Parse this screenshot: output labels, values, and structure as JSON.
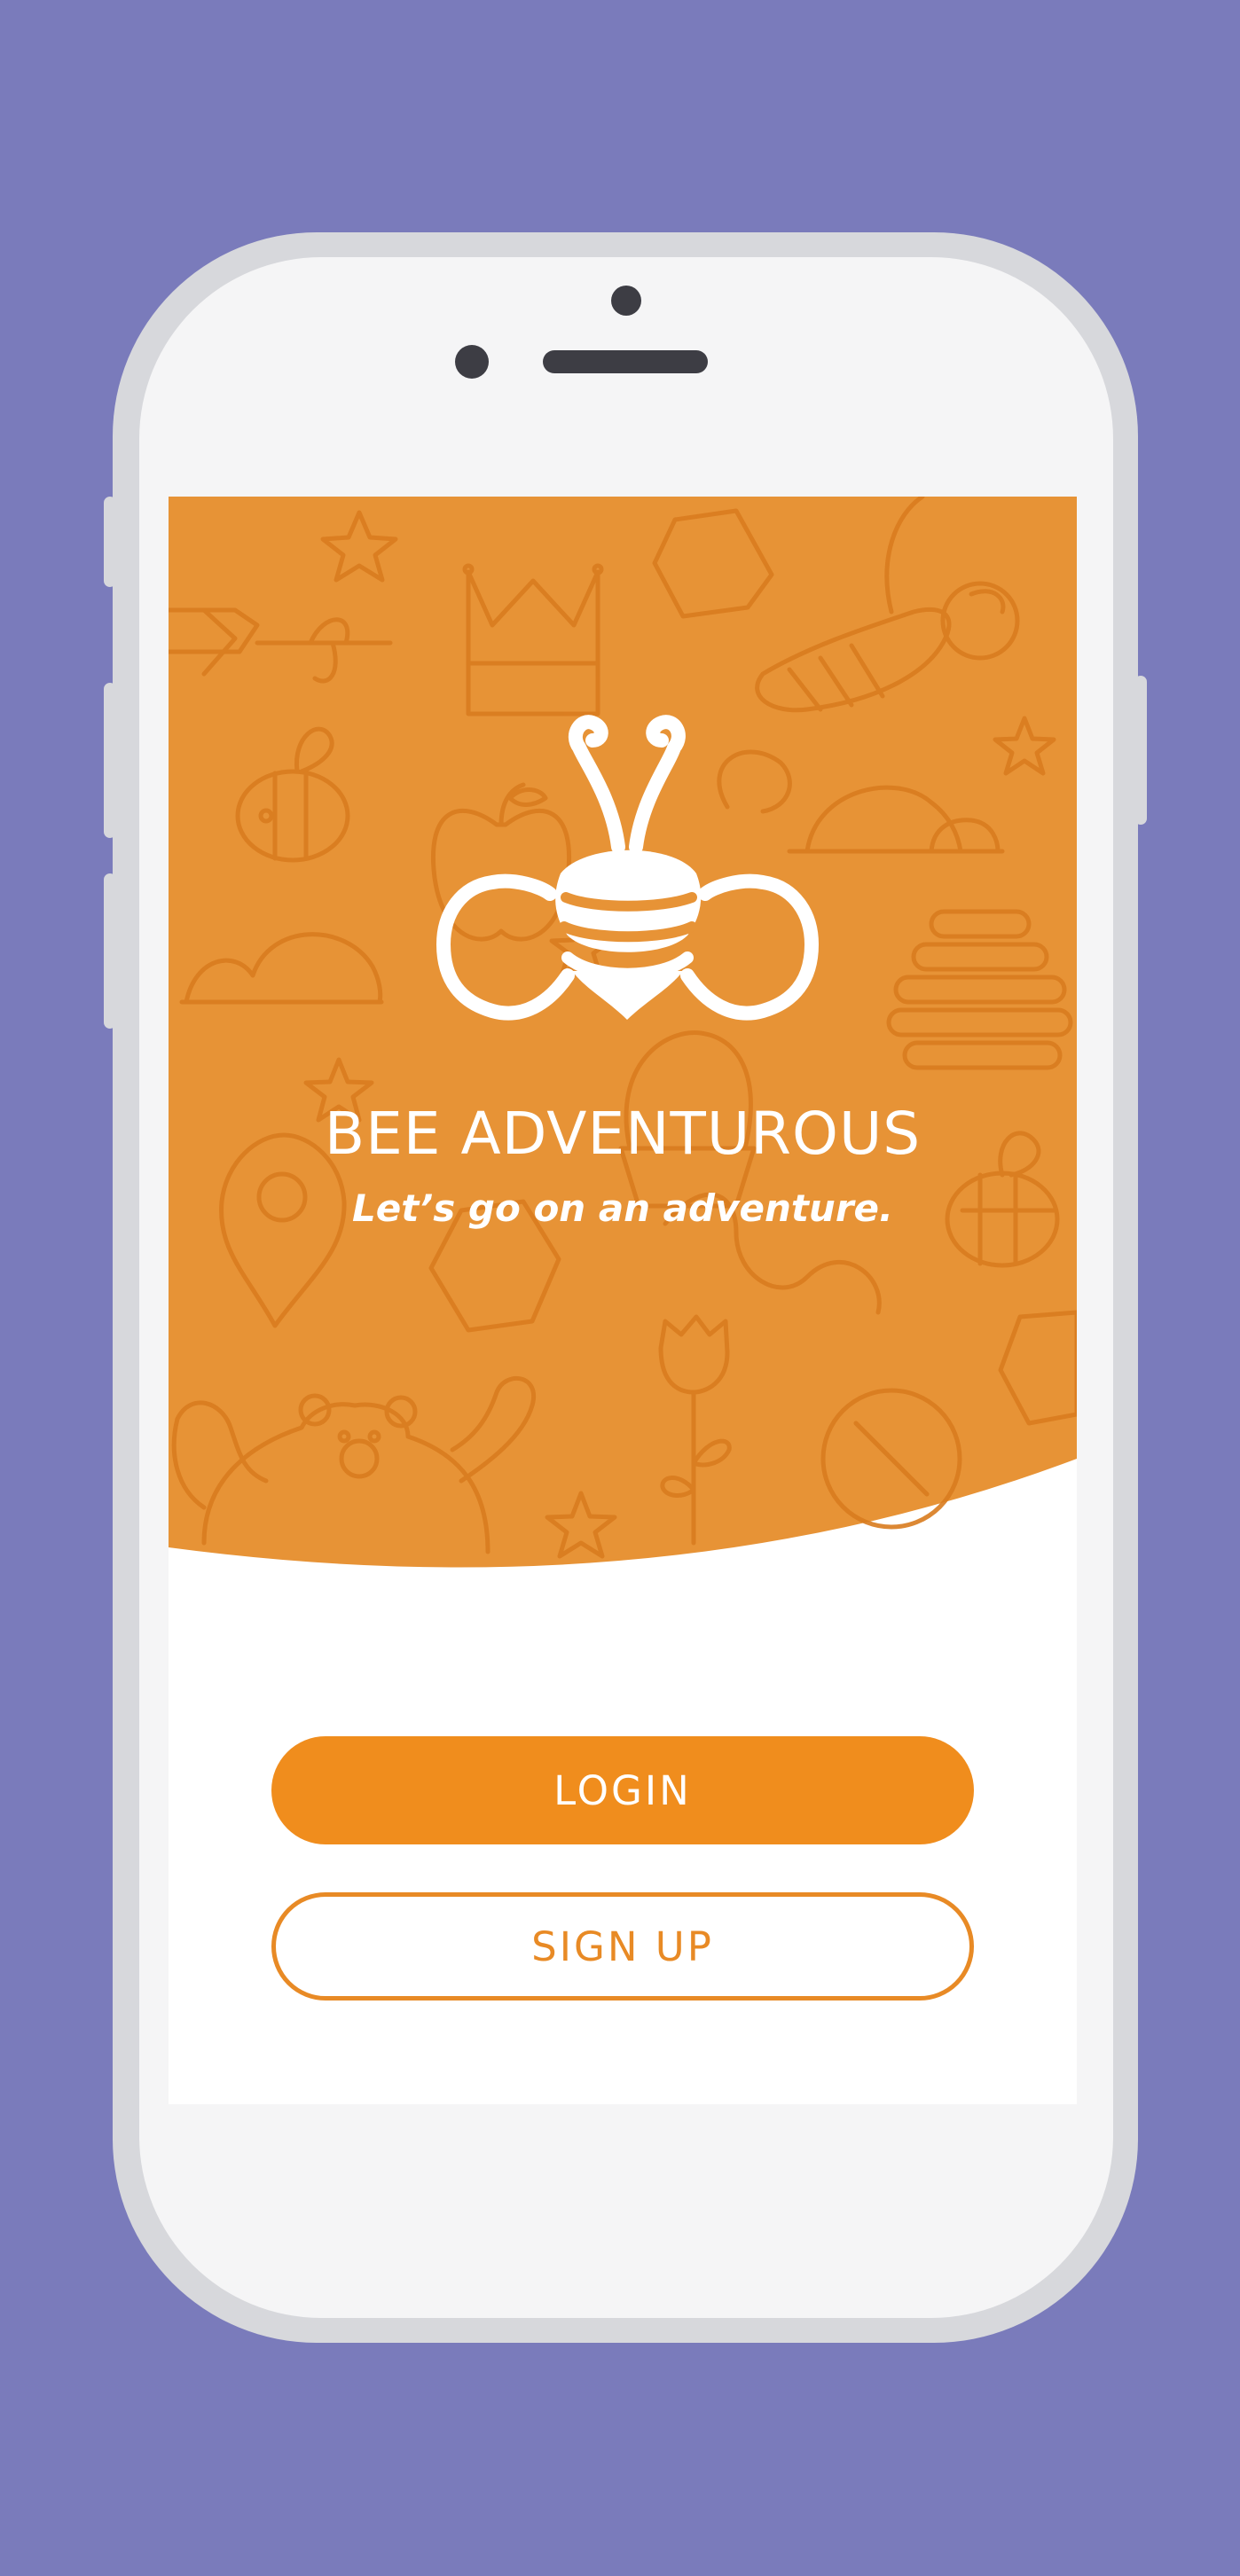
{
  "app": {
    "title": "BEE ADVENTUROUS",
    "tagline": "Let’s go on an adventure."
  },
  "actions": {
    "login_label": "LOGIN",
    "signup_label": "SIGN UP"
  },
  "colors": {
    "background": "#7a7bbb",
    "hero_orange": "#e79336",
    "pattern_stroke": "#d97c1f",
    "button_orange": "#f08d1d",
    "signup_text": "#e88a25",
    "phone_frame": "#d7d8dc",
    "phone_body": "#f5f5f6",
    "white": "#ffffff"
  },
  "icons": {
    "logo": "bee-logo-icon",
    "pattern": [
      "star-icon",
      "crown-icon",
      "hexagon-icon",
      "tulip-icon",
      "bee-icon",
      "apple-icon",
      "hill-icon",
      "map-pin-icon",
      "honeycomb-stack-icon",
      "compass-icon",
      "bear-icon",
      "basket-icon"
    ]
  }
}
